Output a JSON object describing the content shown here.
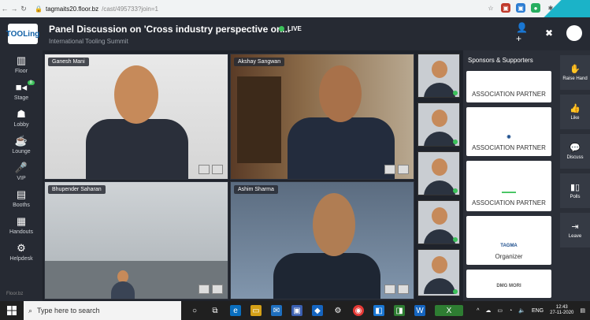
{
  "browser": {
    "url_host": "tagmaits20.floor.bz",
    "url_path": "/cast/495733?join=1"
  },
  "app": {
    "logo_text": "TOOLing",
    "title": "Panel Discussion on 'Cross industry perspective on...",
    "subtitle": "International Tooling Summit",
    "live_label": "LIVE"
  },
  "sidebar": {
    "items": [
      {
        "label": "Floor",
        "icon": "floor-icon"
      },
      {
        "label": "Stage",
        "icon": "stage-icon",
        "badge": "8"
      },
      {
        "label": "Lobby",
        "icon": "lobby-icon"
      },
      {
        "label": "Lounge",
        "icon": "lounge-icon"
      },
      {
        "label": "VIP",
        "icon": "vip-icon"
      },
      {
        "label": "Booths",
        "icon": "booths-icon"
      },
      {
        "label": "Handouts",
        "icon": "handouts-icon"
      },
      {
        "label": "Helpdesk",
        "icon": "helpdesk-icon"
      }
    ],
    "footer": "Floor.bz"
  },
  "stage": {
    "tiles": [
      {
        "name": "Ganesh Mani"
      },
      {
        "name": "Akshay Sangwan"
      },
      {
        "name": "Bhupender Saharan"
      },
      {
        "name": "Ashim Sharma"
      }
    ]
  },
  "sponsors": {
    "title": "Sponsors & Supporters",
    "cards": [
      {
        "label": "ASSOCIATION PARTNER",
        "logo": ""
      },
      {
        "label": "ASSOCIATION PARTNER",
        "logo": ""
      },
      {
        "label": "ASSOCIATION PARTNER",
        "logo": ""
      },
      {
        "label": "Organizer",
        "logo": "TAGMA"
      },
      {
        "label": "",
        "logo": "DMG MORI"
      }
    ]
  },
  "actions": [
    {
      "label": "Raise Hand",
      "icon": "hand-icon"
    },
    {
      "label": "Like",
      "icon": "thumbs-up-icon"
    },
    {
      "label": "Discuss",
      "icon": "chat-icon"
    },
    {
      "label": "Polls",
      "icon": "poll-icon"
    },
    {
      "label": "Leave",
      "icon": "leave-icon"
    }
  ],
  "taskbar": {
    "search_placeholder": "Type here to search",
    "time": "12:43",
    "date": "27-11-2020",
    "lang": "ENG"
  },
  "colors": {
    "accent": "#3cc15a",
    "teal": "#1bb3c8",
    "panel": "#262a33"
  }
}
